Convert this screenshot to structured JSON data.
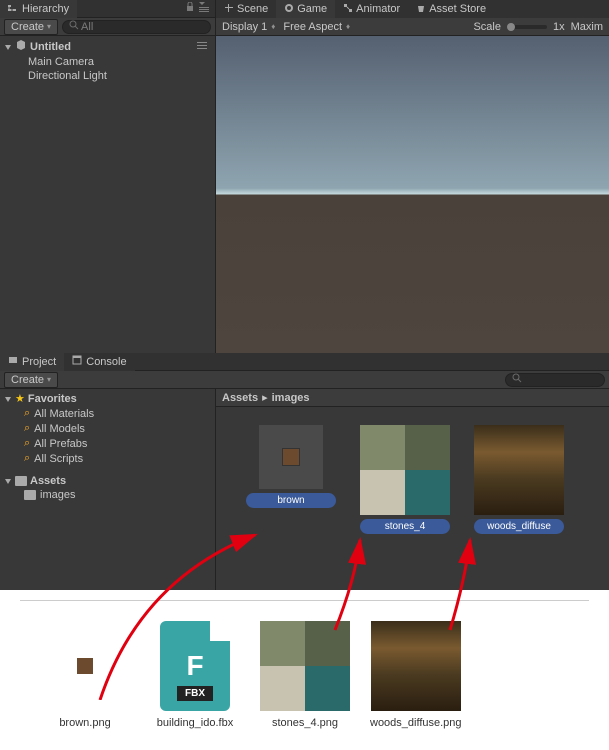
{
  "hierarchy": {
    "tab": "Hierarchy",
    "create": "Create",
    "search_placeholder": "All",
    "scene": "Untitled",
    "items": [
      "Main Camera",
      "Directional Light"
    ]
  },
  "game_tabs": {
    "scene": "Scene",
    "game": "Game",
    "animator": "Animator",
    "asset_store": "Asset Store"
  },
  "game_toolbar": {
    "display": "Display 1",
    "aspect": "Free Aspect",
    "scale_label": "Scale",
    "scale_value": "1x",
    "maximize": "Maxim"
  },
  "project": {
    "tab": "Project",
    "console": "Console",
    "create": "Create",
    "favorites": "Favorites",
    "fav_items": [
      "All Materials",
      "All Models",
      "All Prefabs",
      "All Scripts"
    ],
    "assets": "Assets",
    "folder": "images",
    "breadcrumb_root": "Assets",
    "breadcrumb_sub": "images",
    "grid_items": [
      {
        "label": "brown"
      },
      {
        "label": "stones_4"
      },
      {
        "label": "woods_diffuse"
      }
    ]
  },
  "files": [
    {
      "name": "brown.png"
    },
    {
      "name": "building_ido.fbx"
    },
    {
      "name": "stones_4.png"
    },
    {
      "name": "woods_diffuse.png"
    }
  ],
  "fbx_label": "FBX"
}
